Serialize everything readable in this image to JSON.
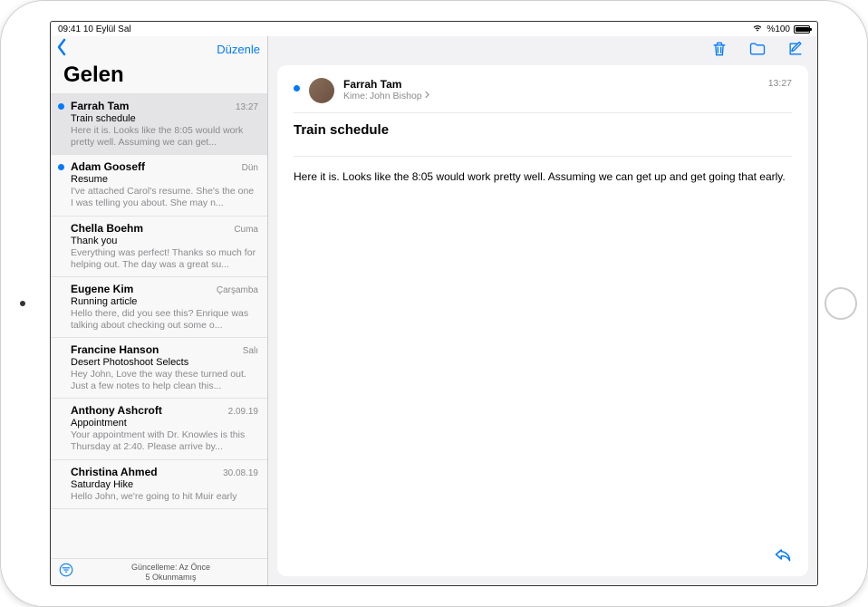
{
  "status": {
    "time": "09:41",
    "date": "10 Eylül Sal",
    "battery": "%100"
  },
  "sidebar": {
    "edit_label": "Düzenle",
    "inbox_title": "Gelen",
    "footer_line1": "Güncelleme: Az Önce",
    "footer_line2": "5 Okunmamış",
    "items": [
      {
        "sender": "Farrah Tam",
        "time": "13:27",
        "subject": "Train schedule",
        "preview": "Here it is. Looks like the 8:05 would work pretty well. Assuming we can get...",
        "unread": true,
        "selected": true
      },
      {
        "sender": "Adam Gooseff",
        "time": "Dün",
        "subject": "Resume",
        "preview": "I've attached Carol's resume. She's the one I was telling you about. She may n...",
        "unread": true,
        "selected": false
      },
      {
        "sender": "Chella Boehm",
        "time": "Cuma",
        "subject": "Thank you",
        "preview": "Everything was perfect! Thanks so much for helping out. The day was a great su...",
        "unread": false,
        "selected": false
      },
      {
        "sender": "Eugene Kim",
        "time": "Çarşamba",
        "subject": "Running article",
        "preview": "Hello there, did you see this? Enrique was talking about checking out some o...",
        "unread": false,
        "selected": false
      },
      {
        "sender": "Francine Hanson",
        "time": "Salı",
        "subject": "Desert Photoshoot Selects",
        "preview": "Hey John, Love the way these turned out. Just a few notes to help clean this...",
        "unread": false,
        "selected": false
      },
      {
        "sender": "Anthony Ashcroft",
        "time": "2.09.19",
        "subject": "Appointment",
        "preview": "Your appointment with Dr. Knowles is this Thursday at 2:40. Please arrive by...",
        "unread": false,
        "selected": false
      },
      {
        "sender": "Christina Ahmed",
        "time": "30.08.19",
        "subject": "Saturday Hike",
        "preview": "Hello John, we're going to hit Muir early",
        "unread": false,
        "selected": false
      }
    ]
  },
  "message": {
    "sender": "Farrah Tam",
    "to_label": "Kime:",
    "to_name": "John Bishop",
    "time": "13:27",
    "subject": "Train schedule",
    "body": "Here it is. Looks like the 8:05 would work pretty well. Assuming we can get up and get going that early."
  }
}
